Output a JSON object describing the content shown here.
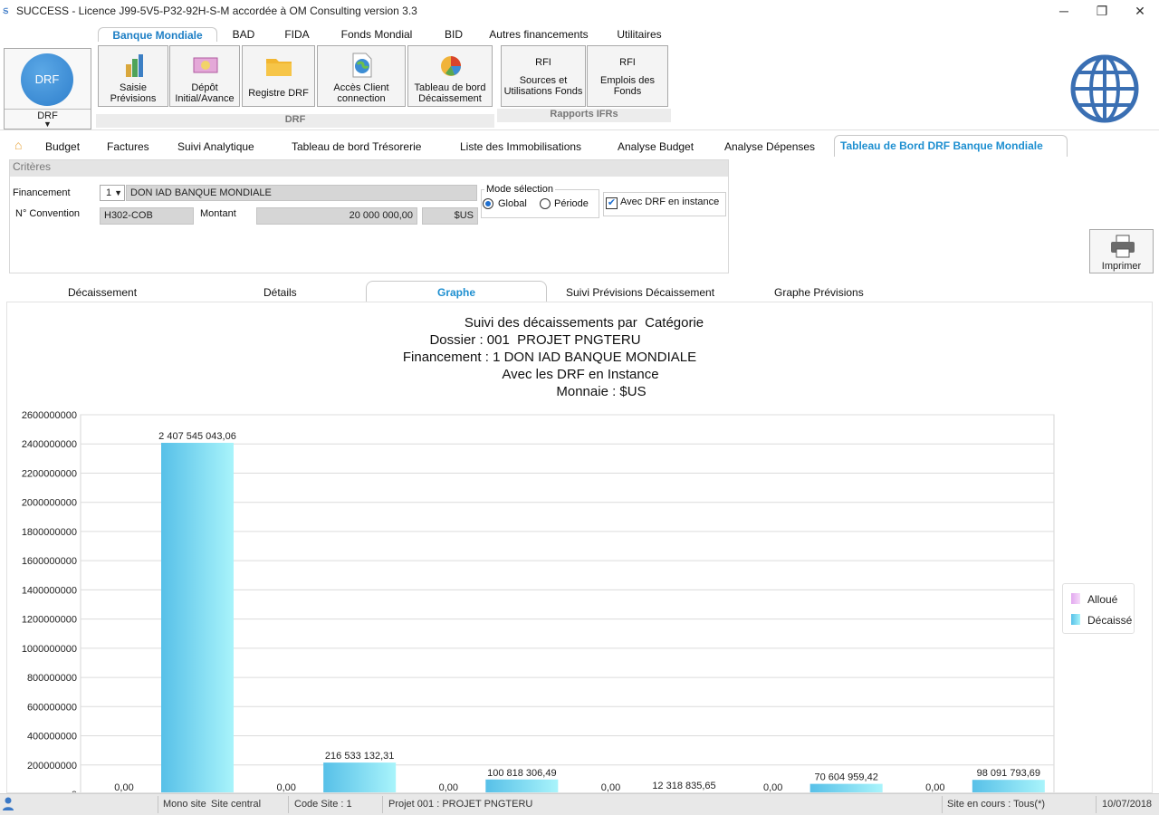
{
  "window": {
    "title": "SUCCESS - Licence J99-5V5-P32-92H-S-M accordée à OM Consulting    version 3.3",
    "min": "─",
    "max": "❐",
    "close": "✕"
  },
  "ribbon_tabs": [
    "Banque Mondiale",
    "BAD",
    "FIDA",
    "Fonds Mondial",
    "BID",
    "Autres financements",
    "Utilitaires"
  ],
  "ribbon": {
    "drf_big": {
      "circle": "DRF",
      "label": "DRF"
    },
    "buttons": [
      {
        "label1": "Saisie",
        "label2": "Prévisions",
        "icon": "money-stack-icon"
      },
      {
        "label1": "Dépôt",
        "label2": "Initial/Avance",
        "icon": "banknote-icon"
      },
      {
        "label1": "Registre DRF",
        "label2": "",
        "icon": "folder-icon"
      },
      {
        "label1": "Accès Client",
        "label2": "connection",
        "icon": "globe-document-icon"
      },
      {
        "label1": "Tableau de bord",
        "label2": "Décaissement",
        "icon": "pie-chart-icon"
      }
    ],
    "group_drf": "DRF",
    "rfi_buttons": [
      {
        "top": "RFI",
        "label1": "Sources et",
        "label2": "Utilisations Fonds"
      },
      {
        "top": "RFI",
        "label1": "Emplois des",
        "label2": "Fonds"
      }
    ],
    "group_rfi": "Rapports IFRs"
  },
  "sub_tabs": [
    "Budget",
    "Factures",
    "Suivi Analytique",
    "Tableau de bord Trésorerie",
    "Liste des Immobilisations",
    "Analyse Budget",
    "Analyse Dépenses",
    "Tableau de Bord DRF Banque Mondiale"
  ],
  "criteria": {
    "title": "Critères",
    "financement_label": "Financement",
    "financement_num": "1",
    "financement_name": "DON IAD BANQUE MONDIALE",
    "convention_label": "N° Convention",
    "convention_value": "H302-COB",
    "montant_label": "Montant",
    "montant_value": "20 000 000,00",
    "currency": "$US",
    "mode_label": "Mode sélection",
    "mode_global": "Global",
    "mode_periode": "Période",
    "avec_drf": "Avec DRF en instance",
    "print": "Imprimer"
  },
  "lower_tabs": [
    "Décaissement",
    "Détails",
    "Graphe",
    "Suivi Prévisions Décaissement",
    "Graphe Prévisions"
  ],
  "status": {
    "mono": "Mono site",
    "site": "Site central",
    "code": "Code Site : 1",
    "projet": "Projet 001 : PROJET PNGTERU",
    "site_cours": "Site en cours : Tous(*)",
    "date": "10/07/2018"
  },
  "colors": {
    "accent": "#1e8fd0",
    "bar_alloue": "#e8b4f0",
    "bar_decaisse": "#5cc8ec"
  },
  "chart_data": {
    "type": "bar",
    "title_lines": [
      "Suivi des décaissements par  Catégorie",
      "Dossier : 001  PROJET PNGTERU",
      "Financement : 1 DON IAD BANQUE MONDIALE",
      "Avec les DRF en Instance",
      "Monnaie : $US"
    ],
    "y_ticks": [
      "2600000000",
      "2400000000",
      "2200000000",
      "2000000000",
      "1800000000",
      "1600000000",
      "1400000000",
      "1200000000",
      "1000000000",
      "800000000",
      "600000000",
      "400000000",
      "200000000",
      "0"
    ],
    "ylim": [
      0,
      2600000000
    ],
    "legend": [
      "Alloué",
      "Décaissé"
    ],
    "legend_position": "right",
    "grid": true,
    "series": [
      {
        "name": "Alloué",
        "values": [
          0,
          0,
          0,
          0,
          0,
          0
        ],
        "labels": [
          "0,00",
          "0,00",
          "0,00",
          "0,00",
          "0,00",
          "0,00"
        ]
      },
      {
        "name": "Décaissé",
        "values": [
          2407545043.06,
          216533132.31,
          100818306.49,
          12318835.65,
          70604959.42,
          98091793.69
        ],
        "labels": [
          "2 407 545 043,06",
          "216 533 132,31",
          "100 818 306,49",
          "12 318 835,65",
          "70 604 959,42",
          "98 091 793,69"
        ]
      }
    ]
  }
}
